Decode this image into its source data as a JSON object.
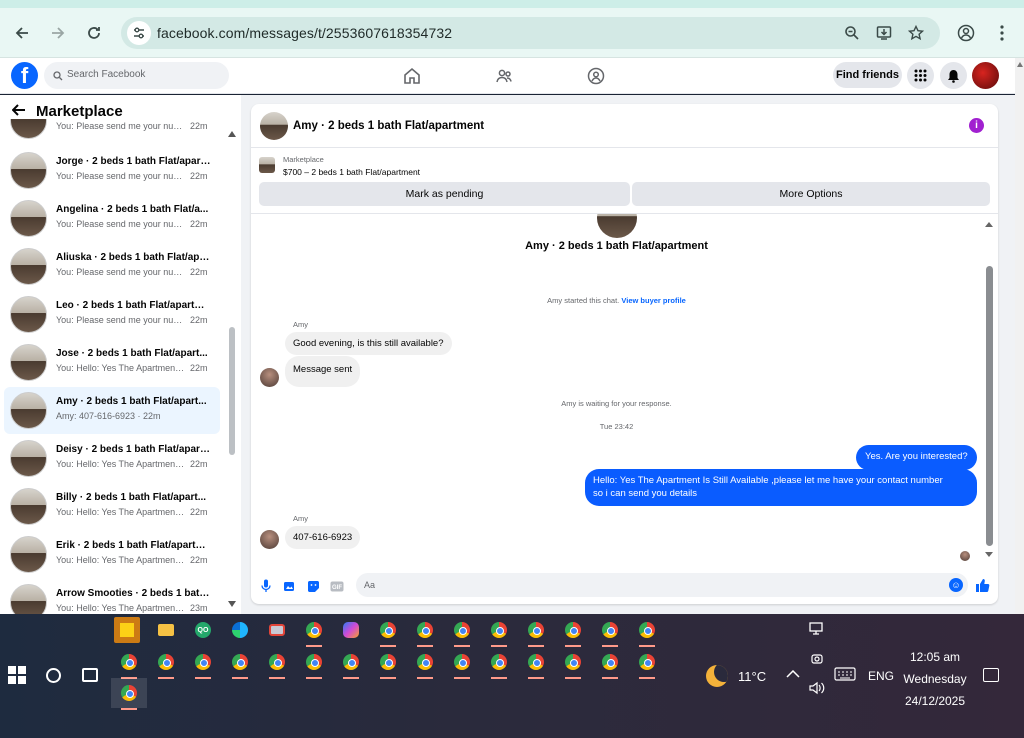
{
  "browser": {
    "url": "facebook.com/messages/t/2553607618354732"
  },
  "fb": {
    "search_placeholder": "Search Facebook",
    "find_friends": "Find friends"
  },
  "sidebar": {
    "title": "Marketplace",
    "conversations": [
      {
        "name": "",
        "preview": "You: Please send me your numb...",
        "time": "22m"
      },
      {
        "name": "Jorge · 2 beds 1 bath Flat/apart...",
        "preview": "You: Please send me your numb...",
        "time": "22m"
      },
      {
        "name": "Angelina · 2 beds 1 bath Flat/a...",
        "preview": "You: Please send me your numb...",
        "time": "22m"
      },
      {
        "name": "Aliuska · 2 beds 1 bath Flat/apa...",
        "preview": "You: Please send me your numb...",
        "time": "22m"
      },
      {
        "name": "Leo · 2 beds 1 bath Flat/apartm...",
        "preview": "You: Please send me your numb...",
        "time": "22m"
      },
      {
        "name": "Jose · 2 beds 1 bath Flat/apart...",
        "preview": "You: Hello: Yes The Apartment Is...",
        "time": "22m"
      },
      {
        "name": "Amy · 2 beds 1 bath Flat/apart...",
        "preview": "Amy: 407-616-6923 · 22m",
        "time": ""
      },
      {
        "name": "Deisy · 2 beds 1 bath Flat/apart...",
        "preview": "You: Hello: Yes The Apartment Is...",
        "time": "22m"
      },
      {
        "name": "Billy · 2 beds 1 bath Flat/apart...",
        "preview": "You: Hello: Yes The Apartment Is...",
        "time": "22m"
      },
      {
        "name": "Erik · 2 beds 1 bath Flat/apartm...",
        "preview": "You: Hello: Yes The Apartment Is...",
        "time": "22m"
      },
      {
        "name": "Arrow Smooties · 2 beds 1 bath...",
        "preview": "You: Hello: Yes The Apartment Is...",
        "time": "23m"
      }
    ]
  },
  "chat": {
    "header_title": "Amy · 2 beds 1 bath Flat/apartment",
    "listing_label": "Marketplace",
    "listing_price": "$700 – 2 beds 1 bath Flat/apartment",
    "mark_pending": "Mark as pending",
    "more_options": "More Options",
    "conversation_title": "Amy · 2 beds 1 bath Flat/apartment",
    "started_text": "Amy started this chat.",
    "view_profile": "View buyer profile",
    "sender_1": "Amy",
    "msg_1": "Good evening, is this still available?",
    "msg_2": "Message sent",
    "waiting_text": "Amy is waiting for your response.",
    "timestamp": "Tue 23:42",
    "out_1": "Yes. Are you interested?",
    "out_2_line1": "Hello: Yes The Apartment Is Still Available ,please let me have your contact number",
    "out_2_line2": "so i can send you details",
    "sender_2": "Amy",
    "msg_3": "407-616-6923",
    "composer_placeholder": "Aa"
  },
  "taskbar": {
    "temperature": "11°C",
    "language": "ENG",
    "time": "12:05 am",
    "day": "Wednesday",
    "date": "24/12/2025"
  }
}
